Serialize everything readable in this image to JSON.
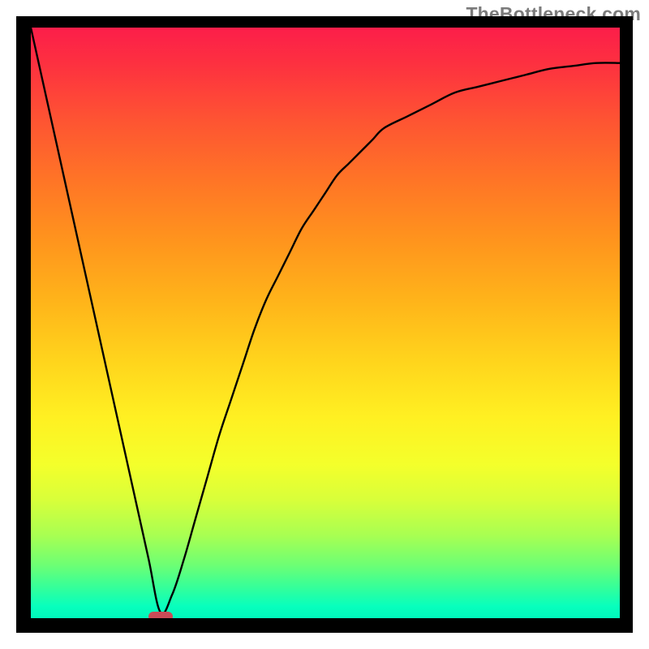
{
  "watermark": "TheBottleneck.com",
  "colors": {
    "frame": "#000000",
    "curve": "#000000",
    "marker": "#cc4b57",
    "gradient_top": "#fc1e4a",
    "gradient_bottom": "#00f7bb"
  },
  "chart_data": {
    "type": "line",
    "title": "",
    "xlabel": "",
    "ylabel": "",
    "xlim": [
      0,
      100
    ],
    "ylim": [
      0,
      100
    ],
    "grid": false,
    "legend": false,
    "note": "V-shaped bottleneck curve with steep left descent, minimum near x≈22, asymptotic rise toward right.",
    "x": [
      0,
      2,
      4,
      6,
      8,
      10,
      12,
      14,
      16,
      18,
      20,
      22,
      24,
      26,
      28,
      30,
      32,
      34,
      36,
      38,
      40,
      42,
      44,
      46,
      48,
      50,
      52,
      54,
      56,
      58,
      60,
      64,
      68,
      72,
      76,
      80,
      84,
      88,
      92,
      96,
      100
    ],
    "values": [
      100,
      91,
      82,
      73,
      64,
      55,
      46,
      37,
      28,
      19,
      10,
      1,
      4,
      10,
      17,
      24,
      31,
      37,
      43,
      49,
      54,
      58,
      62,
      66,
      69,
      72,
      75,
      77,
      79,
      81,
      83,
      85,
      87,
      89,
      90,
      91,
      92,
      93,
      93.5,
      94,
      94
    ],
    "marker": {
      "x": 22,
      "y": 0
    }
  }
}
